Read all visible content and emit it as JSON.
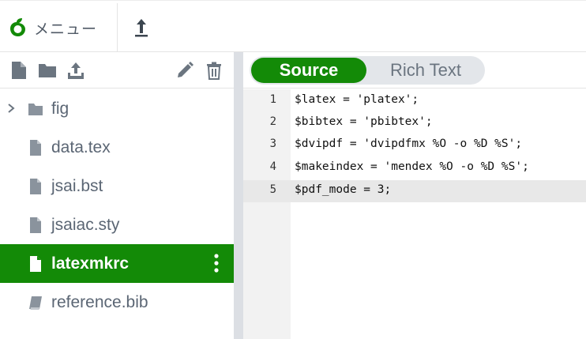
{
  "header": {
    "menu_label": "メニュー",
    "brand_color": "#138a07",
    "icons": [
      "leaf-logo-icon",
      "upload-arrow-icon"
    ]
  },
  "sidebar": {
    "toolbar_icons": [
      "new-file-icon",
      "new-folder-icon",
      "upload-icon",
      "rename-pencil-icon",
      "delete-trash-icon"
    ],
    "files": [
      {
        "name": "fig",
        "type": "folder",
        "collapsed": true
      },
      {
        "name": "data.tex",
        "type": "file"
      },
      {
        "name": "jsai.bst",
        "type": "file"
      },
      {
        "name": "jsaiac.sty",
        "type": "file"
      },
      {
        "name": "latexmkrc",
        "type": "file",
        "selected": true
      },
      {
        "name": "reference.bib",
        "type": "bib"
      }
    ],
    "selected_color": "#138a07"
  },
  "editor": {
    "mode_toggle": {
      "source_label": "Source",
      "rich_label": "Rich Text",
      "active": "Source"
    },
    "active_line": 5,
    "lines": [
      {
        "num": "1",
        "text": "$latex = 'platex';"
      },
      {
        "num": "2",
        "text": "$bibtex = 'pbibtex';"
      },
      {
        "num": "3",
        "text": "$dvipdf = 'dvipdfmx %O -o %D %S';"
      },
      {
        "num": "4",
        "text": "$makeindex = 'mendex %O -o %D %S';"
      },
      {
        "num": "5",
        "text": "$pdf_mode = 3;"
      }
    ]
  }
}
